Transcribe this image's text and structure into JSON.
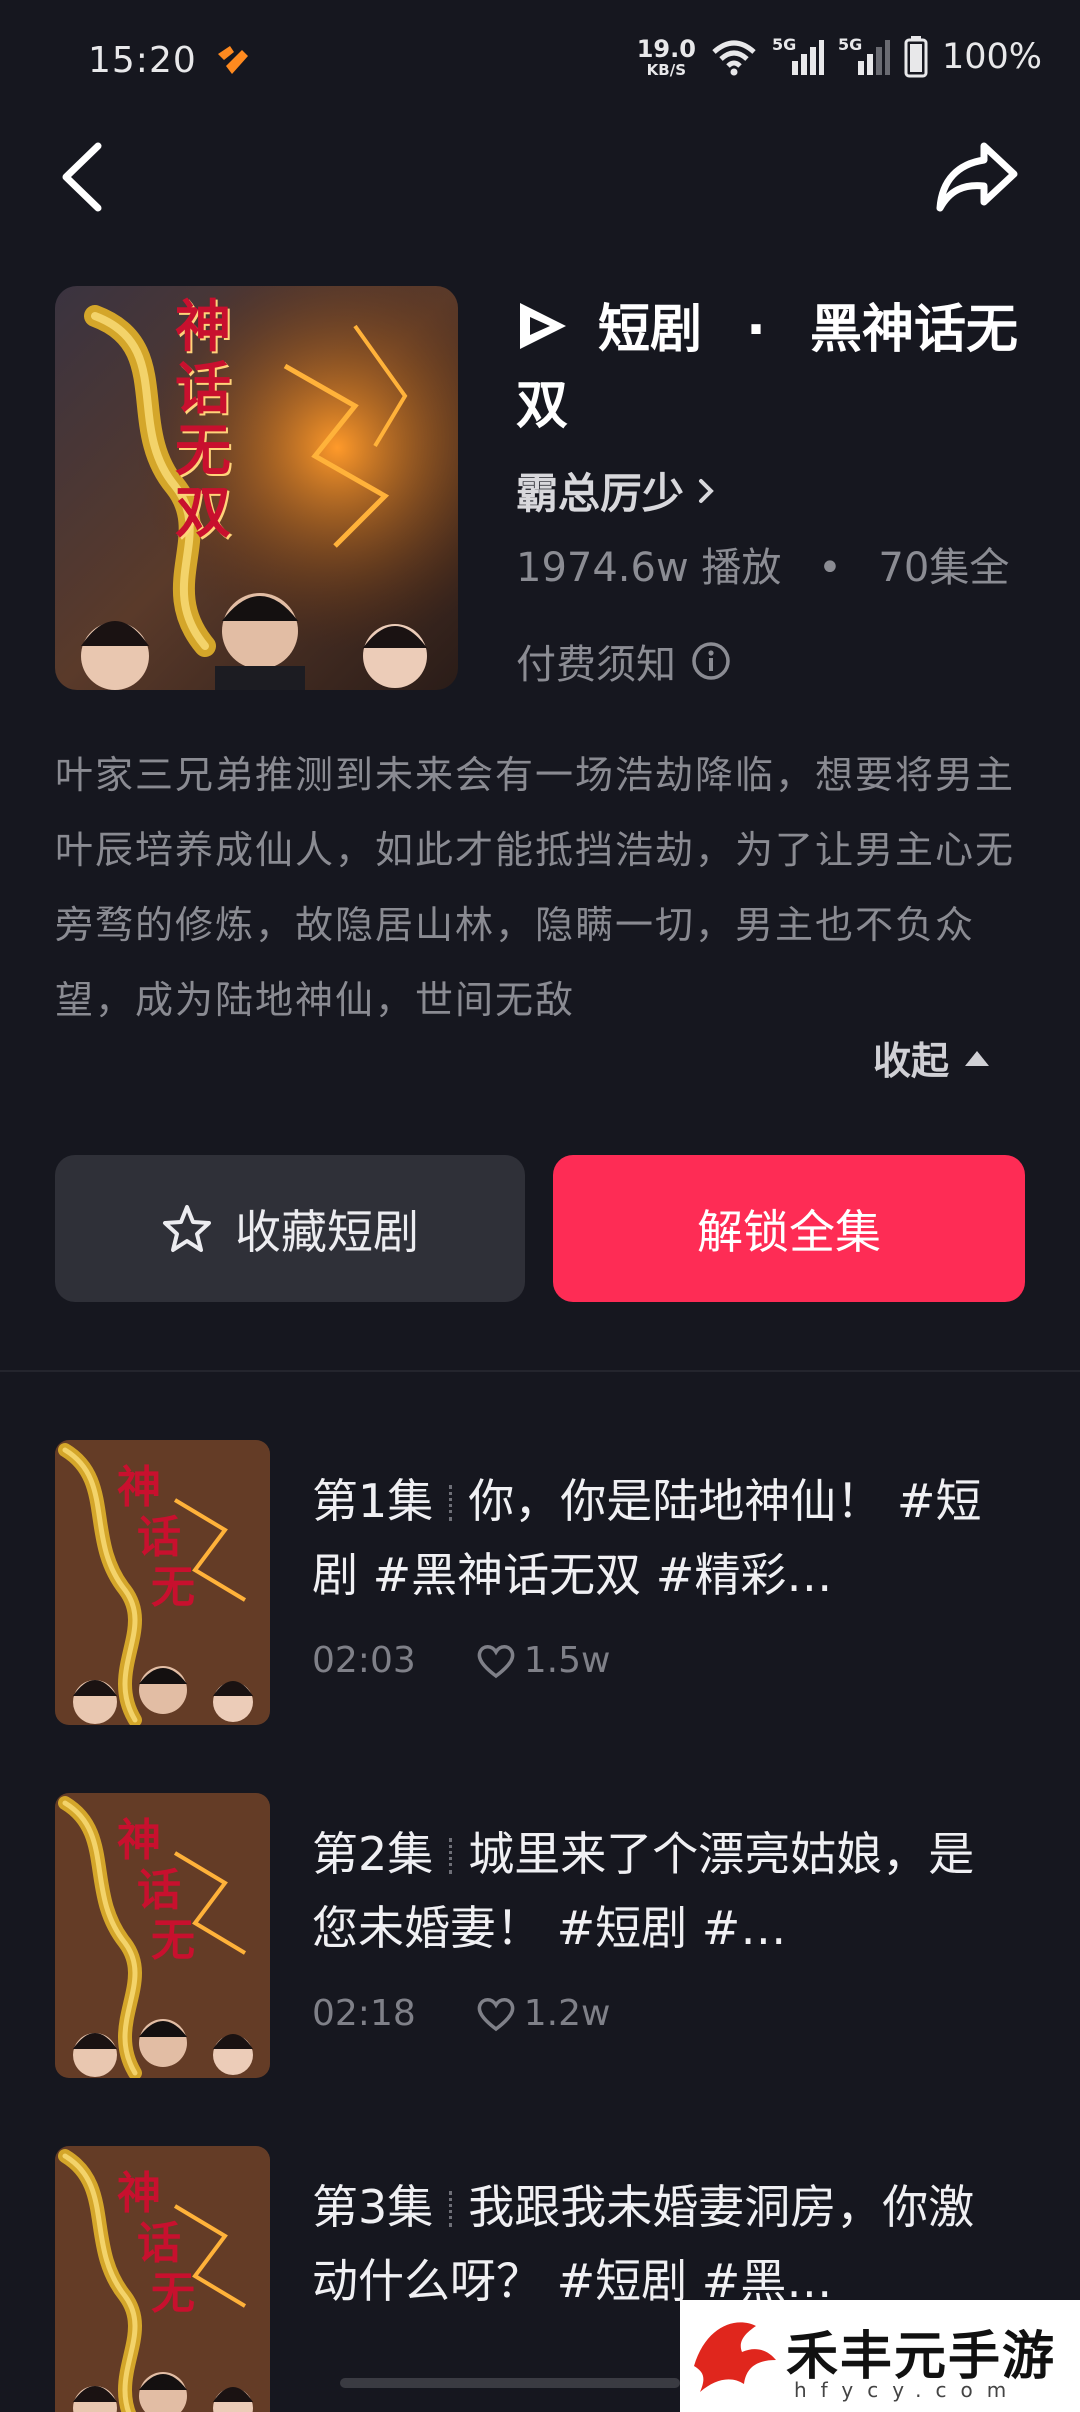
{
  "status_bar": {
    "time": "15:20",
    "net_speed_value": "19.0",
    "net_speed_unit": "KB/S",
    "signal_1_label": "5G",
    "signal_2_label": "5G",
    "battery": "100%"
  },
  "drama": {
    "category_label": "短剧",
    "title_separator": "·",
    "title": "黑神话无双",
    "author": "霸总厉少",
    "play_count": "1974.6w 播放",
    "stats_dot": "•",
    "episodes_total": "70集全",
    "pay_notice": "付费须知",
    "cover_text": "神话无双",
    "description": "叶家三兄弟推测到未来会有一场浩劫降临，想要将男主叶辰培养成仙人，如此才能抵挡浩劫，为了让男主心无旁骛的修炼，故隐居山林，隐瞒一切，男主也不负众望，成为陆地神仙，世间无敌",
    "collapse_label": "收起"
  },
  "buttons": {
    "favorite_label": "收藏短剧",
    "unlock_label": "解锁全集"
  },
  "episodes": [
    {
      "number": "第1集",
      "title": "你，你是陆地神仙！ #短剧 #黑神话无双 #精彩…",
      "duration": "02:03",
      "likes": "1.5w"
    },
    {
      "number": "第2集",
      "title": "城里来了个漂亮姑娘，是您未婚妻！ #短剧 #…",
      "duration": "02:18",
      "likes": "1.2w"
    },
    {
      "number": "第3集",
      "title": "我跟我未婚妻洞房，你激动什么呀？ #短剧 #黑…",
      "duration": "",
      "likes": ""
    }
  ],
  "watermark": {
    "text": "禾丰元手游",
    "url": "hfycy.com"
  },
  "colors": {
    "background": "#16171f",
    "accent": "#fe2c55",
    "secondary_button": "#2f3038",
    "muted_text": "#8a8b92"
  }
}
